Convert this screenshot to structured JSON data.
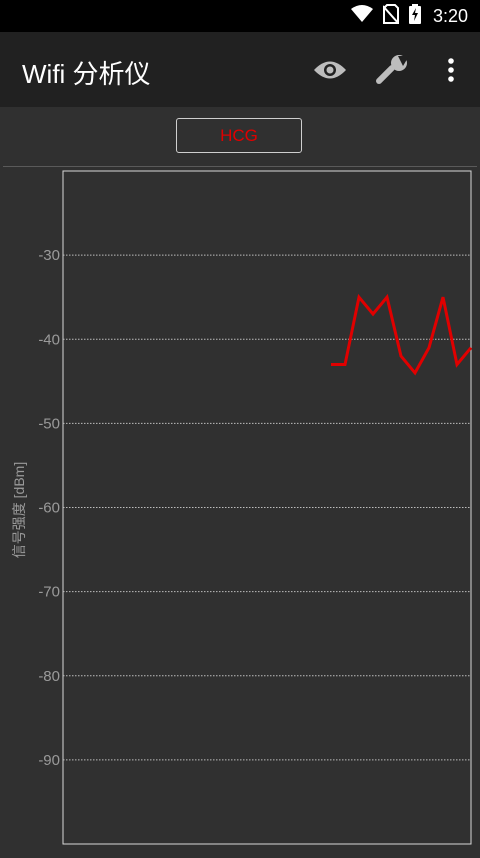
{
  "status_bar": {
    "time": "3:20"
  },
  "toolbar": {
    "title": "Wifi 分析仪",
    "icons": [
      "eye-icon",
      "wrench-icon",
      "more-vert-icon"
    ]
  },
  "filter": {
    "ssid_label": "HCG"
  },
  "colors": {
    "background": "#303030",
    "toolbar": "#212121",
    "series": "#e00000",
    "grid": "#bdbdbd"
  },
  "chart_data": {
    "type": "line",
    "ylabel": "信号强度 [dBm]",
    "ylim": [
      -100,
      -20
    ],
    "yticks": [
      -30,
      -40,
      -50,
      -60,
      -70,
      -80,
      -90
    ],
    "ytick_labels": [
      "-30",
      "-40",
      "-50",
      "-60",
      "-70",
      "-80",
      "-90"
    ],
    "grid": true,
    "series": [
      {
        "values": [
          -43,
          -43,
          -35,
          -37,
          -35,
          -42,
          -44,
          -41,
          -35,
          -43,
          -41
        ]
      }
    ]
  }
}
